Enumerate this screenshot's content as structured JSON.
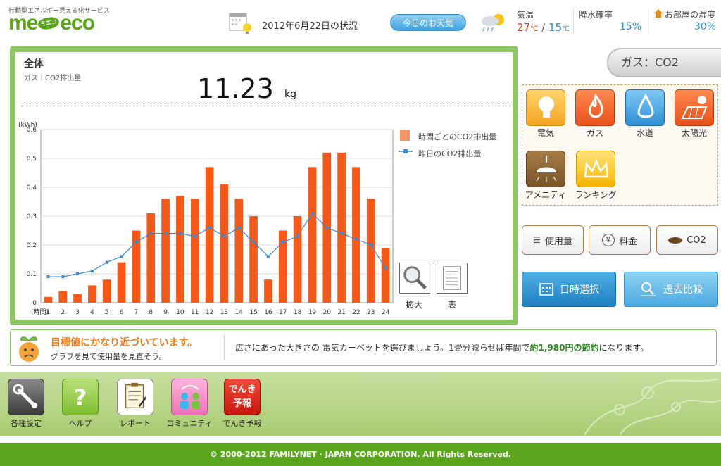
{
  "header": {
    "logo_tagline": "行動型エネルギー見える化サービス",
    "logo_left": "me",
    "logo_mid": "ミエコ",
    "logo_right": "eco",
    "date_title": "2012年6月22日の状況",
    "weather_button": "今日のお天気",
    "temp_label": "気温",
    "temp_high": "27",
    "temp_low": "15",
    "temp_unit": "℃",
    "rain_label": "降水確率",
    "rain_value": "15%",
    "humidity_label": "お部屋の湿度",
    "humidity_value": "30%"
  },
  "panel": {
    "title": "全体",
    "subtitle": "ガス｜CO2排出量",
    "value": "11.23",
    "unit": "kg",
    "legend_bar": "時間ごとのCO2排出量",
    "legend_line": "昨日のCO2排出量",
    "zoom_label": "拡大",
    "table_label": "表"
  },
  "chart_data": {
    "type": "bar",
    "ylabel": "(kWh)",
    "xlabel": "(時間)",
    "ylim": [
      0,
      0.6
    ],
    "yticks": [
      "0",
      "0.1",
      "0.2",
      "0.3",
      "0.4",
      "0.5",
      "0.6"
    ],
    "categories": [
      "1",
      "2",
      "3",
      "4",
      "5",
      "6",
      "7",
      "8",
      "9",
      "10",
      "11",
      "12",
      "13",
      "14",
      "15",
      "16",
      "17",
      "18",
      "19",
      "20",
      "21",
      "22",
      "23",
      "24"
    ],
    "series": [
      {
        "name": "時間ごとのCO2排出量",
        "type": "bar",
        "color": "#f4591a",
        "values": [
          0.02,
          0.04,
          0.03,
          0.06,
          0.08,
          0.14,
          0.25,
          0.31,
          0.36,
          0.37,
          0.36,
          0.47,
          0.41,
          0.36,
          0.3,
          0.08,
          0.25,
          0.3,
          0.47,
          0.52,
          0.52,
          0.47,
          0.36,
          0.19
        ]
      },
      {
        "name": "昨日のCO2排出量",
        "type": "line",
        "color": "#3a8bd0",
        "values": [
          0.09,
          0.09,
          0.1,
          0.11,
          0.14,
          0.16,
          0.21,
          0.24,
          0.24,
          0.24,
          0.23,
          0.26,
          0.23,
          0.26,
          0.21,
          0.16,
          0.21,
          0.23,
          0.31,
          0.26,
          0.24,
          0.22,
          0.2,
          0.12
        ]
      }
    ]
  },
  "sidebar": {
    "category_tab": "ガス：CO2",
    "categories": [
      {
        "label": "電気",
        "icon": "lightbulb-icon",
        "color": "#f5a623"
      },
      {
        "label": "ガス",
        "icon": "flame-icon",
        "color": "#e8501c"
      },
      {
        "label": "水道",
        "icon": "water-drop-icon",
        "color": "#2f8fd5"
      },
      {
        "label": "太陽光",
        "icon": "solar-panel-icon",
        "color": "#e8501c"
      },
      {
        "label": "アメニティ",
        "icon": "ceiling-lamp-icon",
        "color": "#8a6130"
      },
      {
        "label": "ランキング",
        "icon": "crown-icon",
        "color": "#f5b400"
      }
    ],
    "mode_usage": "使用量",
    "mode_cost": "料金",
    "mode_co2": "CO2",
    "date_select": "日時選択",
    "past_compare": "過去比較"
  },
  "message": {
    "headline": "目標値にかなり近づいています。",
    "sub": "グラフを見て使用量を見直そう。",
    "tip_pre": "広さにあった大きさの 電気カーペットを選びましょう。1畳分減らせば年間で",
    "tip_bold": "約1,980円の節約",
    "tip_post": "になります。"
  },
  "footer": {
    "items": [
      {
        "label": "各種設定",
        "icon": "wrench-icon"
      },
      {
        "label": "ヘルプ",
        "icon": "help-icon",
        "glyph": "?"
      },
      {
        "label": "レポート",
        "icon": "report-icon"
      },
      {
        "label": "コミュニティ",
        "icon": "community-icon"
      },
      {
        "label": "でんき予報",
        "icon": "forecast-icon",
        "glyph1": "でんき",
        "glyph2": "予報"
      }
    ],
    "copyright": "© 2000-2012 FAMILYNET · JAPAN CORPORATION. All Rights Reserved."
  }
}
